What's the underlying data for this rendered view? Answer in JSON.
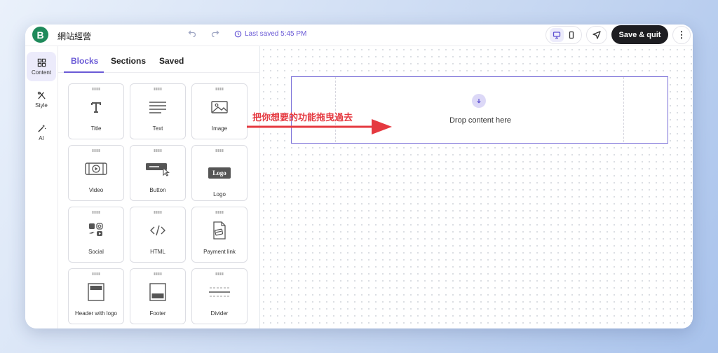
{
  "app": {
    "logo_letter": "B",
    "site_name": "網站經營",
    "saved_status": "Last saved 5:45 PM",
    "save_quit_label": "Save & quit",
    "more_label": "⋮"
  },
  "rail": {
    "items": [
      {
        "label": "Content",
        "icon": "grid-icon",
        "active": true
      },
      {
        "label": "Style",
        "icon": "pen-tools-icon",
        "active": false
      },
      {
        "label": "AI",
        "icon": "magic-wand-icon",
        "active": false
      }
    ]
  },
  "panel": {
    "tabs": [
      {
        "label": "Blocks",
        "active": true
      },
      {
        "label": "Sections",
        "active": false
      },
      {
        "label": "Saved",
        "active": false
      }
    ],
    "blocks": [
      {
        "label": "Title",
        "icon": "title-icon"
      },
      {
        "label": "Text",
        "icon": "text-lines-icon"
      },
      {
        "label": "Image",
        "icon": "image-icon"
      },
      {
        "label": "Video",
        "icon": "video-icon"
      },
      {
        "label": "Button",
        "icon": "button-cursor-icon"
      },
      {
        "label": "Logo",
        "icon": "logo-icon",
        "icon_text": "Logo"
      },
      {
        "label": "Social",
        "icon": "social-icons"
      },
      {
        "label": "HTML",
        "icon": "code-icon"
      },
      {
        "label": "Payment link",
        "icon": "payment-link-icon"
      },
      {
        "label": "Header with logo",
        "icon": "header-layout-icon"
      },
      {
        "label": "Footer",
        "icon": "footer-layout-icon"
      },
      {
        "label": "Divider",
        "icon": "divider-icon"
      }
    ]
  },
  "canvas": {
    "drop_text": "Drop content here",
    "annotation": "把你想要的功能拖曳過去"
  },
  "colors": {
    "accent": "#6a5ad6",
    "brand": "#1f8a5b",
    "annotation": "#e53940",
    "dark_button": "#1d1d21"
  }
}
